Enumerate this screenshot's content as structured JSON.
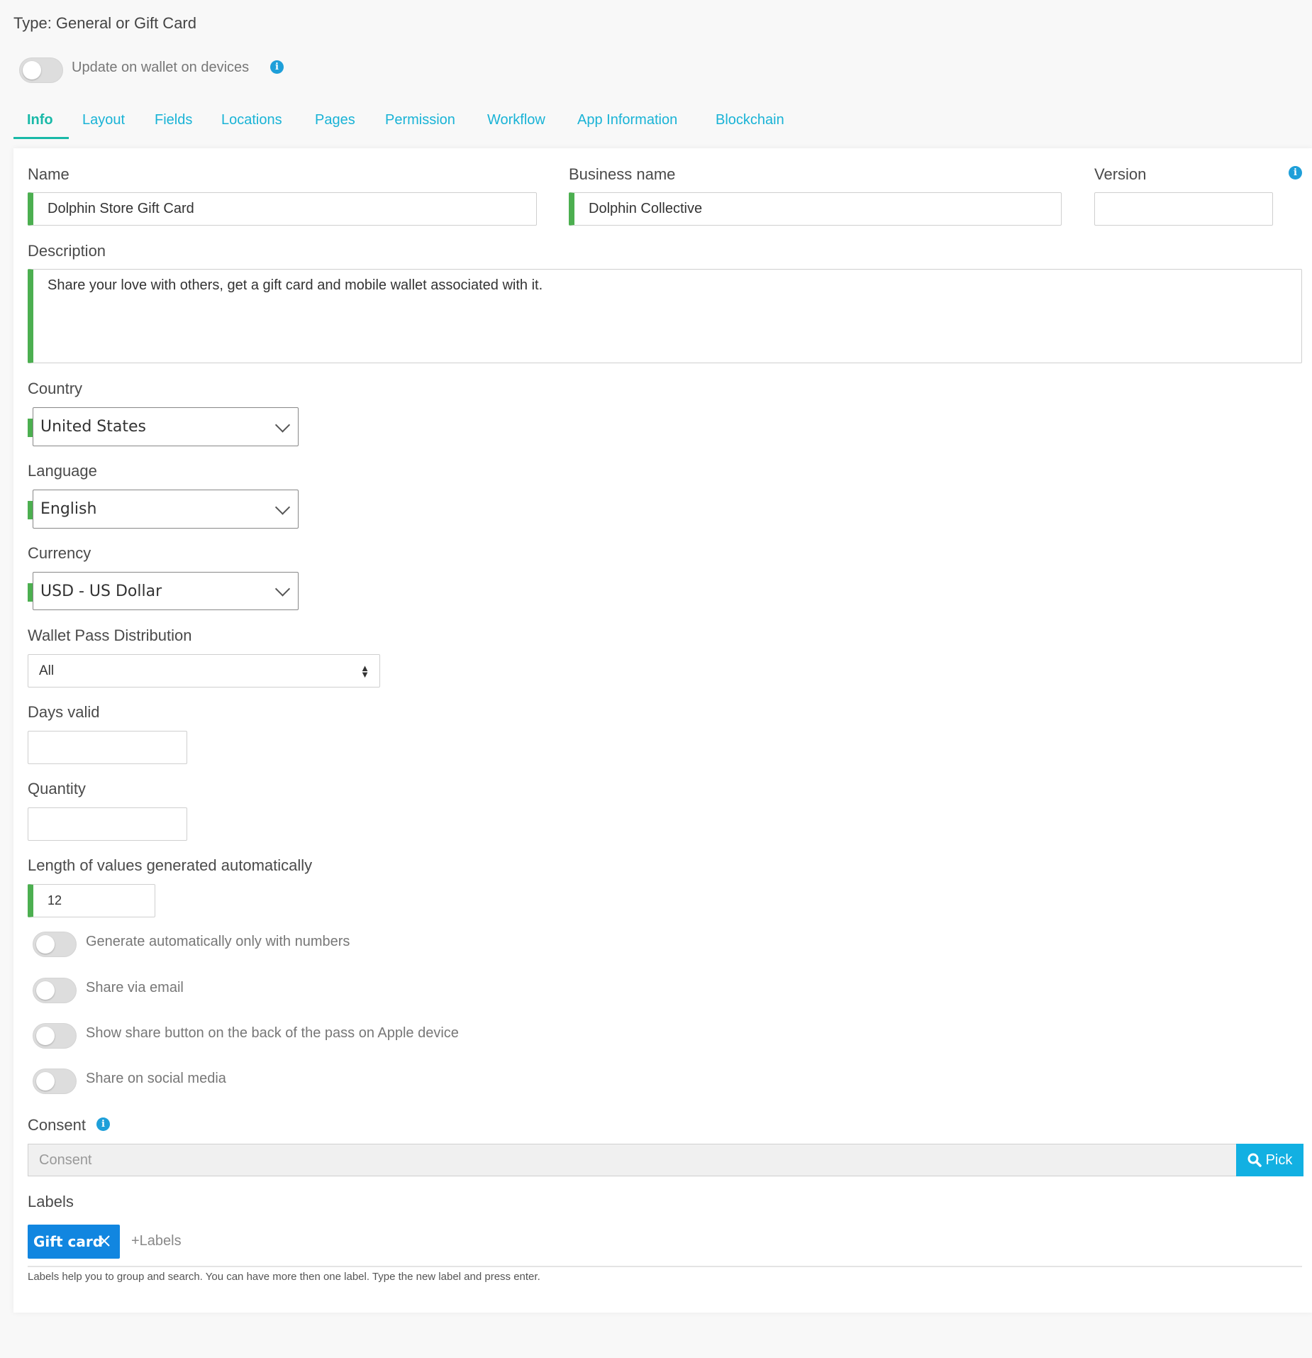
{
  "header": {
    "type_title": "Type: General or Gift Card",
    "wallet_toggle_label": "Update on wallet on devices"
  },
  "tabs": [
    {
      "label": "Info",
      "active": true
    },
    {
      "label": "Layout"
    },
    {
      "label": "Fields"
    },
    {
      "label": "Locations"
    },
    {
      "label": "Pages"
    },
    {
      "label": "Permission"
    },
    {
      "label": "Workflow"
    },
    {
      "label": "App Information"
    },
    {
      "label": "Blockchain"
    }
  ],
  "form": {
    "name": {
      "label": "Name",
      "value": "Dolphin Store Gift Card"
    },
    "business_name": {
      "label": "Business name",
      "value": "Dolphin Collective"
    },
    "version": {
      "label": "Version",
      "value": ""
    },
    "description": {
      "label": "Description",
      "value": "Share your love with others, get a gift card and mobile wallet associated with it."
    },
    "country": {
      "label": "Country",
      "value": "United States"
    },
    "language": {
      "label": "Language",
      "value": "English"
    },
    "currency": {
      "label": "Currency",
      "value": "USD - US Dollar"
    },
    "wallet_distribution": {
      "label": "Wallet Pass Distribution",
      "value": "All"
    },
    "days_valid": {
      "label": "Days valid",
      "value": ""
    },
    "quantity": {
      "label": "Quantity",
      "value": ""
    },
    "auto_length": {
      "label": "Length of values generated automatically",
      "value": "12"
    },
    "toggles": [
      {
        "label": "Generate automatically only with numbers",
        "on": false
      },
      {
        "label": "Share via email",
        "on": false
      },
      {
        "label": "Show share button on the back of the pass on Apple device",
        "on": false
      },
      {
        "label": "Share on social media",
        "on": false
      }
    ],
    "consent": {
      "label": "Consent",
      "placeholder": "Consent",
      "pick_label": "Pick"
    },
    "labels": {
      "label": "Labels",
      "tags": [
        "Gift card"
      ],
      "add_placeholder": "+Labels",
      "help": "Labels help you to group and search. You can have more then one label. Type the new label and press enter."
    }
  },
  "colors": {
    "accent": "#19b3d6",
    "active_tab": "#19b9a8",
    "required_bar": "#4caf50",
    "pick_button": "#12b0e2",
    "tag": "#1186e0"
  }
}
